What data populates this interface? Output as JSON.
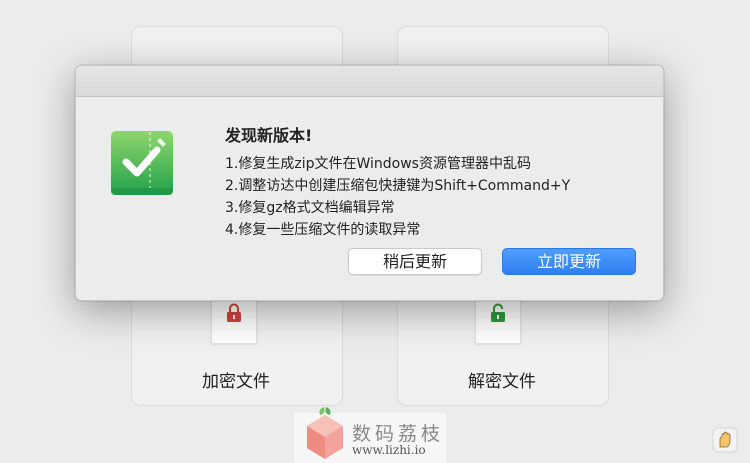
{
  "cards": {
    "encrypt_label": "加密文件",
    "decrypt_label": "解密文件"
  },
  "dialog": {
    "title": "发现新版本!",
    "notes": [
      "1.修复生成zip文件在Windows资源管理器中乱码",
      "2.调整访达中创建压缩包快捷键为Shift+Command+Y",
      "3.修复gz格式文档编辑异常",
      "4.修复一些压缩文件的读取异常"
    ],
    "later_button": "稍后更新",
    "update_button": "立即更新"
  },
  "watermark": {
    "cn": "数码荔枝",
    "url": "www.lizhi.io"
  },
  "colors": {
    "accent": "#2f7ff3",
    "app_icon_green": "#3cb64b",
    "lock_red": "#d9423c",
    "lock_green": "#2e9b3a"
  }
}
